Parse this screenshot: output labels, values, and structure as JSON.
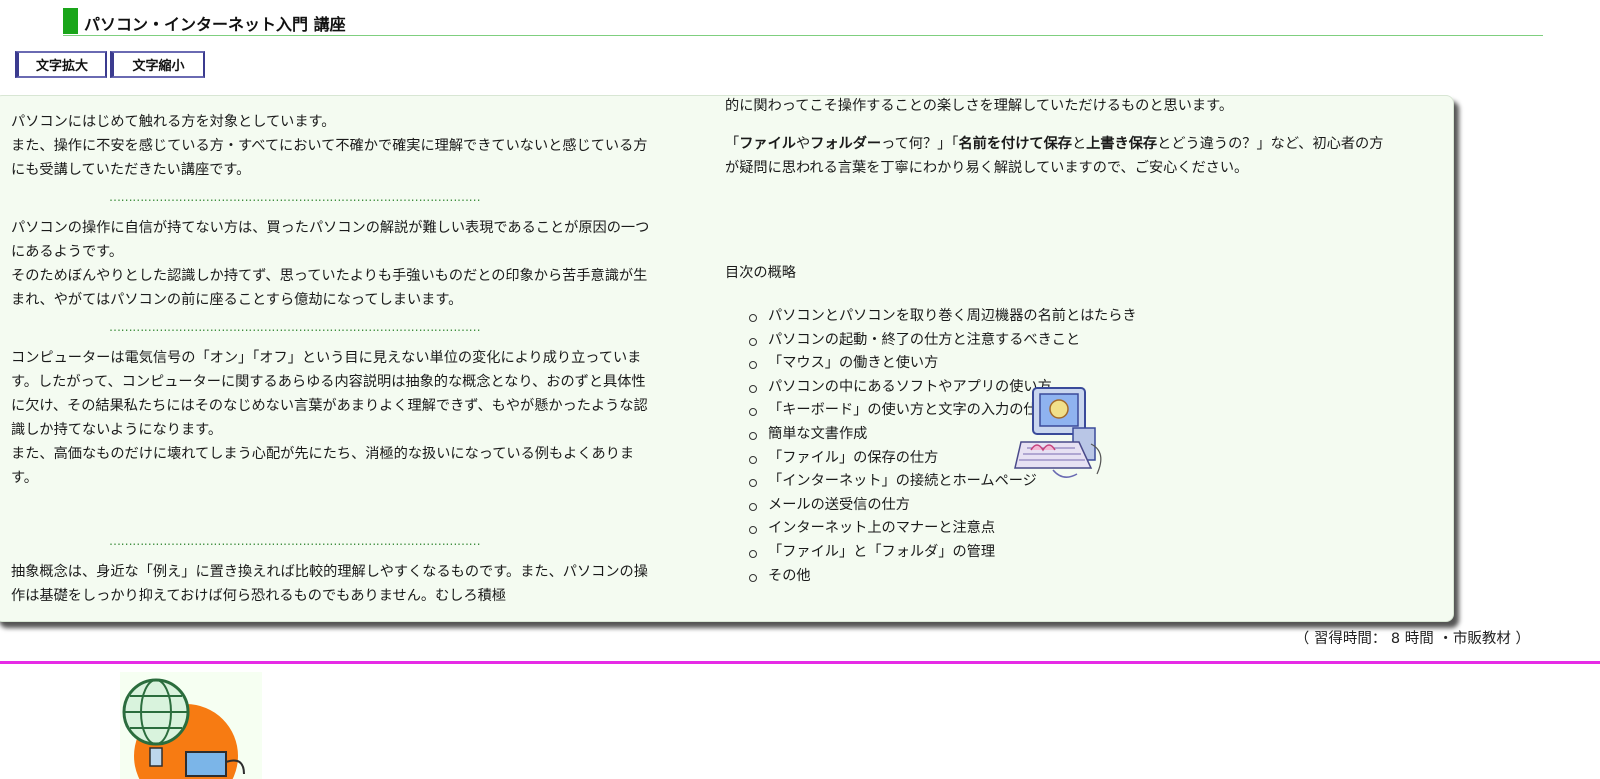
{
  "header": {
    "title": "パソコン・インターネット入門 講座",
    "accent": "#1aa51a"
  },
  "controls": {
    "enlarge_label": "文字拡大",
    "shrink_label": "文字縮小"
  },
  "left_column": {
    "p1_line1": "パソコンにはじめて触れる方を対象としています。",
    "p1_line2": "また、操作に不安を感じている方・すべてにおいて不確かで確実に理解できていないと感じている方にも受講していただきたい講座です。",
    "dots": "……………………………………………………………………………………",
    "p2_line1": "パソコンの操作に自信が持てない方は、買ったパソコンの解説が難しい表現であることが原因の一つにあるようです。",
    "p2_line2": "そのためぼんやりとした認識しか持てず、思っていたよりも手強いものだとの印象から苦手意識が生まれ、やがてはパソコンの前に座ることすら億劫になってしまいます。",
    "p3_line1": "コンピューターは電気信号の「オン」「オフ」という目に見えない単位の変化により成り立っています。したがって、コンピューターに関するあらゆる内容説明は抽象的な概念となり、おのずと具体性に欠け、その結果私たちにはそのなじめない言葉があまりよく理解できず、もやが懸かったような認識しか持てないようになります。",
    "p3_line2": "また、高価なものだけに壊れてしまう心配が先にたち、消極的な扱いになっている例もよくあります。",
    "p4": "抽象概念は、身近な「例え」に置き換えれば比較的理解しやすくなるものです。また、パソコンの操作は基礎をしっかり抑えておけば何ら恐れるものでもありません。むしろ積極"
  },
  "right_column": {
    "p4_cont": "的に関わってこそ操作することの楽しさを理解していただけるものと思います。",
    "q_open": "「",
    "q_file": "ファイル",
    "q_ya": "や",
    "q_folder": "フォルダー",
    "q_mid1": "って何？」「",
    "q_save_as": "名前を付けて保存",
    "q_to": "と",
    "q_overwrite": "上書き保存",
    "q_rest": "とどう違うの？」など、初心者の方が疑問に思われる言葉を丁寧にわかり易く解説していますので、ご安心ください。",
    "toc_title": "目次の概略",
    "toc": [
      "パソコンとパソコンを取り巻く周辺機器の名前とはたらき",
      "パソコンの起動・終了の仕方と注意するべきこと",
      "「マウス」の働きと使い方",
      "パソコンの中にあるソフトやアプリの使い方",
      "「キーボード」の使い方と文字の入力の仕方",
      "簡単な文書作成",
      "「ファイル」の保存の仕方",
      "「インターネット」の接続とホームページ",
      "メールの送受信の仕方",
      "インターネット上のマナーと注意点",
      "「ファイル」と「フォルダ」の管理",
      "その他"
    ]
  },
  "footer": {
    "note": "（ 習得時間： 8 時間 ・市販教材 ）",
    "divider_color": "#e62ae6"
  }
}
